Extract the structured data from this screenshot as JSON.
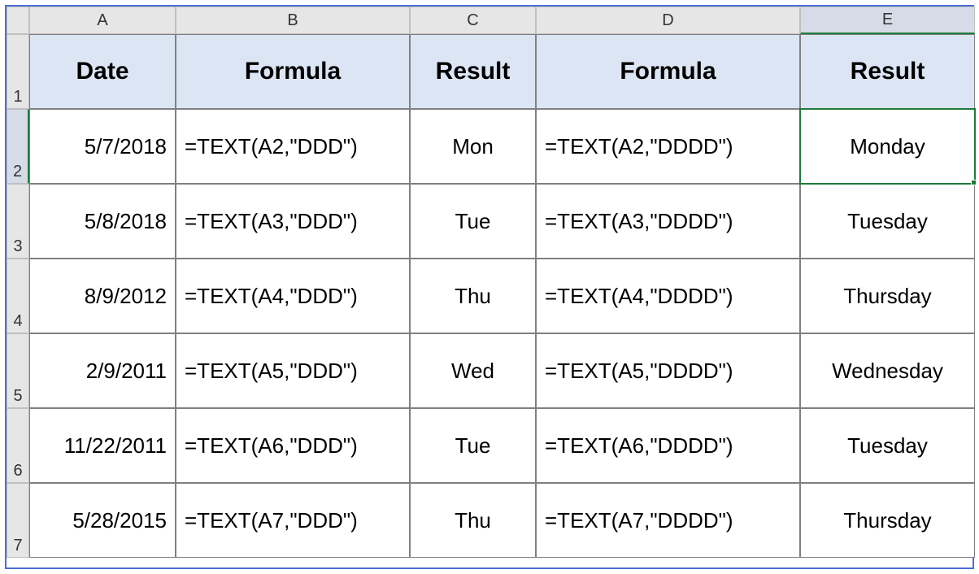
{
  "columns": [
    "A",
    "B",
    "C",
    "D",
    "E"
  ],
  "rows": [
    "1",
    "2",
    "3",
    "4",
    "5",
    "6",
    "7"
  ],
  "headers": [
    "Date",
    "Formula",
    "Result",
    "Formula",
    "Result"
  ],
  "activeCell": "E2",
  "data": [
    {
      "date": "5/7/2018",
      "formula1": "=TEXT(A2,\"DDD\")",
      "result1": "Mon",
      "formula2": "=TEXT(A2,\"DDDD\")",
      "result2": "Monday"
    },
    {
      "date": "5/8/2018",
      "formula1": "=TEXT(A3,\"DDD\")",
      "result1": "Tue",
      "formula2": "=TEXT(A3,\"DDDD\")",
      "result2": "Tuesday"
    },
    {
      "date": "8/9/2012",
      "formula1": "=TEXT(A4,\"DDD\")",
      "result1": "Thu",
      "formula2": "=TEXT(A4,\"DDDD\")",
      "result2": "Thursday"
    },
    {
      "date": "2/9/2011",
      "formula1": "=TEXT(A5,\"DDD\")",
      "result1": "Wed",
      "formula2": "=TEXT(A5,\"DDDD\")",
      "result2": "Wednesday"
    },
    {
      "date": "11/22/2011",
      "formula1": "=TEXT(A6,\"DDD\")",
      "result1": "Tue",
      "formula2": "=TEXT(A6,\"DDDD\")",
      "result2": "Tuesday"
    },
    {
      "date": "5/28/2015",
      "formula1": "=TEXT(A7,\"DDD\")",
      "result1": "Thu",
      "formula2": "=TEXT(A7,\"DDDD\")",
      "result2": "Thursday"
    }
  ]
}
